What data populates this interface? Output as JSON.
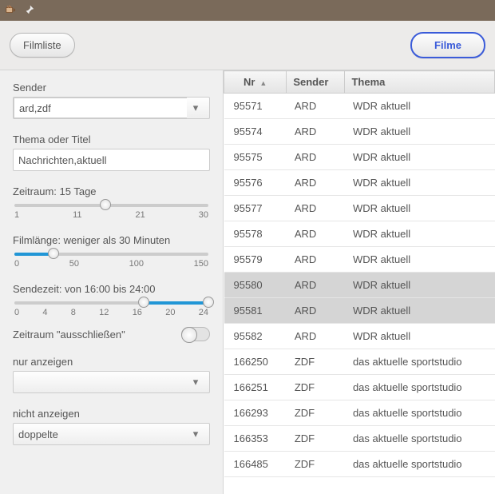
{
  "toolbar": {
    "filmliste": "Filmliste",
    "filme": "Filme"
  },
  "sidebar": {
    "sender_label": "Sender",
    "sender_value": "ard,zdf",
    "thema_label": "Thema oder Titel",
    "thema_value": "Nachrichten,aktuell",
    "zeitraum_label": "Zeitraum: 15 Tage",
    "zeitraum_ticks": [
      "1",
      "11",
      "21",
      "30"
    ],
    "filmlaenge_label": "Filmlänge: weniger als 30 Minuten",
    "filmlaenge_ticks": [
      "0",
      "50",
      "100",
      "150"
    ],
    "sendezeit_label": "Sendezeit: von 16:00 bis 24:00",
    "sendezeit_ticks": [
      "0",
      "4",
      "8",
      "12",
      "16",
      "20",
      "24"
    ],
    "ausschliessen_label": "Zeitraum \"ausschließen\"",
    "nur_anzeigen_label": "nur anzeigen",
    "nur_anzeigen_value": "",
    "nicht_anzeigen_label": "nicht anzeigen",
    "nicht_anzeigen_value": "doppelte"
  },
  "table": {
    "headers": {
      "nr": "Nr",
      "sender": "Sender",
      "thema": "Thema"
    },
    "rows": [
      {
        "nr": "95571",
        "sender": "ARD",
        "thema": "WDR aktuell",
        "sel": false
      },
      {
        "nr": "95574",
        "sender": "ARD",
        "thema": "WDR aktuell",
        "sel": false
      },
      {
        "nr": "95575",
        "sender": "ARD",
        "thema": "WDR aktuell",
        "sel": false
      },
      {
        "nr": "95576",
        "sender": "ARD",
        "thema": "WDR aktuell",
        "sel": false
      },
      {
        "nr": "95577",
        "sender": "ARD",
        "thema": "WDR aktuell",
        "sel": false
      },
      {
        "nr": "95578",
        "sender": "ARD",
        "thema": "WDR aktuell",
        "sel": false
      },
      {
        "nr": "95579",
        "sender": "ARD",
        "thema": "WDR aktuell",
        "sel": false
      },
      {
        "nr": "95580",
        "sender": "ARD",
        "thema": "WDR aktuell",
        "sel": true
      },
      {
        "nr": "95581",
        "sender": "ARD",
        "thema": "WDR aktuell",
        "sel": true
      },
      {
        "nr": "95582",
        "sender": "ARD",
        "thema": "WDR aktuell",
        "sel": false
      },
      {
        "nr": "166250",
        "sender": "ZDF",
        "thema": "das aktuelle sportstudio",
        "sel": false
      },
      {
        "nr": "166251",
        "sender": "ZDF",
        "thema": "das aktuelle sportstudio",
        "sel": false
      },
      {
        "nr": "166293",
        "sender": "ZDF",
        "thema": "das aktuelle sportstudio",
        "sel": false
      },
      {
        "nr": "166353",
        "sender": "ZDF",
        "thema": "das aktuelle sportstudio",
        "sel": false
      },
      {
        "nr": "166485",
        "sender": "ZDF",
        "thema": "das aktuelle sportstudio",
        "sel": false
      }
    ]
  },
  "sliders": {
    "zeitraum": {
      "thumb_pct": 47
    },
    "filmlaenge": {
      "fill_start_pct": 0,
      "fill_end_pct": 20,
      "thumb_pct": 20
    },
    "sendezeit": {
      "fill_start_pct": 66.7,
      "fill_end_pct": 100,
      "thumb1_pct": 66.7,
      "thumb2_pct": 100
    }
  }
}
